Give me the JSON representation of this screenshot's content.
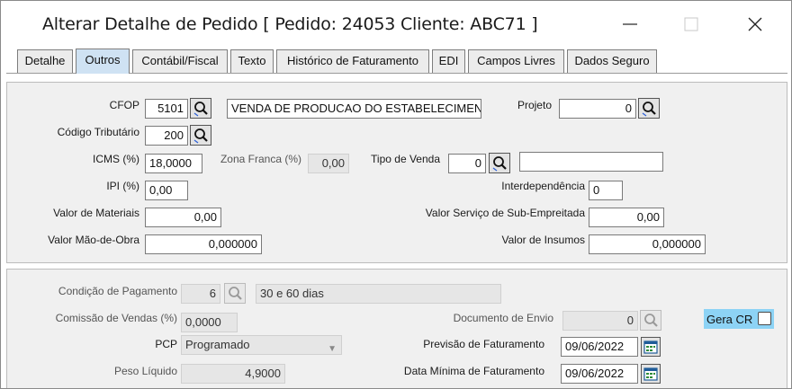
{
  "window": {
    "title": "Alterar Detalhe de Pedido [ Pedido: 24053  Cliente: ABC71 ]",
    "minimize_icon": "minimize-icon",
    "maximize_icon": "maximize-icon",
    "close_icon": "close-icon"
  },
  "tabs": [
    {
      "label": "Detalhe",
      "active": false
    },
    {
      "label": "Outros",
      "active": true
    },
    {
      "label": "Contábil/Fiscal",
      "active": false
    },
    {
      "label": "Texto",
      "active": false
    },
    {
      "label": "Histórico de Faturamento",
      "active": false
    },
    {
      "label": "EDI",
      "active": false
    },
    {
      "label": "Campos Livres",
      "active": false
    },
    {
      "label": "Dados Seguro",
      "active": false
    }
  ],
  "form": {
    "cfop": {
      "label": "CFOP",
      "value": "5101",
      "description": "VENDA DE PRODUCAO DO ESTABELECIMENTO"
    },
    "projeto": {
      "label": "Projeto",
      "value": "0"
    },
    "codigo_tributario": {
      "label": "Código Tributário",
      "value": "200"
    },
    "icms": {
      "label": "ICMS (%)",
      "value": "18,0000"
    },
    "zona_franca": {
      "label": "Zona Franca (%)",
      "value": "0,00"
    },
    "tipo_venda": {
      "label": "Tipo de Venda",
      "value": "0",
      "description": ""
    },
    "ipi": {
      "label": "IPI (%)",
      "value": "0,00"
    },
    "interdependencia": {
      "label": "Interdependência",
      "value": "0"
    },
    "valor_materiais": {
      "label": "Valor de Materiais",
      "value": "0,00"
    },
    "valor_servico": {
      "label": "Valor Serviço de Sub-Empreitada",
      "value": "0,00"
    },
    "valor_mao_obra": {
      "label": "Valor Mão-de-Obra",
      "value": "0,000000"
    },
    "valor_insumos": {
      "label": "Valor de Insumos",
      "value": "0,000000"
    }
  },
  "form2": {
    "condicao_pagamento": {
      "label": "Condição de Pagamento",
      "value": "6",
      "description": "30 e 60 dias"
    },
    "comissao_vendas": {
      "label": "Comissão de Vendas (%)",
      "value": "0,0000"
    },
    "documento_envio": {
      "label": "Documento de Envio",
      "value": "0"
    },
    "gera_cr": {
      "label": "Gera CR",
      "checked": false
    },
    "pcp": {
      "label": "PCP",
      "value": "Programado"
    },
    "previsao_faturamento": {
      "label": "Previsão de Faturamento",
      "value": "09/06/2022"
    },
    "peso_liquido": {
      "label": "Peso Líquido",
      "value": "4,9000"
    },
    "data_minima_faturamento": {
      "label": "Data Mínima de Faturamento",
      "value": "09/06/2022"
    }
  },
  "icons": {
    "search": "search-icon",
    "calendar": "calendar-icon",
    "dropdown": "chevron-down-icon"
  },
  "colors": {
    "active_tab": "#cfe2f3",
    "gera_cr_highlight": "#8dd3f5",
    "panel_bg": "#f0f0f0"
  }
}
